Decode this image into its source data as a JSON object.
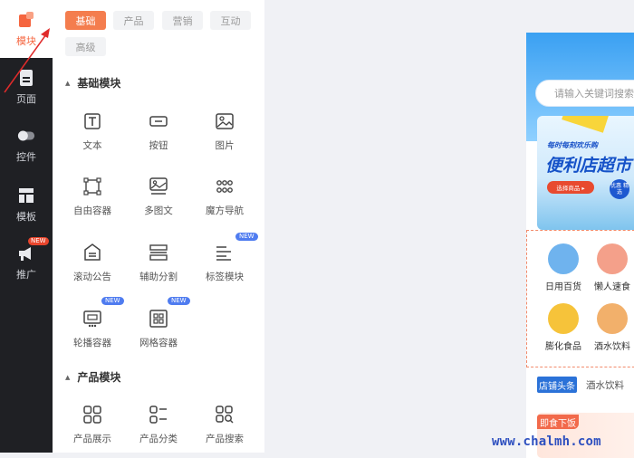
{
  "rail": {
    "items": [
      {
        "label": "模块",
        "icon": "module-icon",
        "active": true
      },
      {
        "label": "页面",
        "icon": "page-icon"
      },
      {
        "label": "控件",
        "icon": "toggle-icon"
      },
      {
        "label": "模板",
        "icon": "template-icon"
      },
      {
        "label": "推广",
        "icon": "megaphone-icon",
        "badge": "NEW"
      }
    ]
  },
  "tabs": [
    "基础",
    "产品",
    "营销",
    "互动",
    "高级"
  ],
  "sections": {
    "basic": {
      "title": "基础模块",
      "widgets": [
        {
          "label": "文本",
          "icon": "text-icon"
        },
        {
          "label": "按钮",
          "icon": "button-icon"
        },
        {
          "label": "图片",
          "icon": "image-icon"
        },
        {
          "label": "自由容器",
          "icon": "free-container-icon"
        },
        {
          "label": "多图文",
          "icon": "multi-image-text-icon"
        },
        {
          "label": "魔方导航",
          "icon": "cube-nav-icon"
        },
        {
          "label": "滚动公告",
          "icon": "notice-icon"
        },
        {
          "label": "辅助分割",
          "icon": "divider-icon"
        },
        {
          "label": "标签模块",
          "icon": "tag-icon",
          "badge": "NEW"
        },
        {
          "label": "轮播容器",
          "icon": "carousel-icon",
          "badge": "NEW"
        },
        {
          "label": "网格容器",
          "icon": "grid-container-icon",
          "badge": "NEW"
        }
      ]
    },
    "product": {
      "title": "产品模块",
      "widgets": [
        {
          "label": "产品展示",
          "icon": "product-display-icon"
        },
        {
          "label": "产品分类",
          "icon": "product-category-icon"
        },
        {
          "label": "产品搜索",
          "icon": "product-search-icon"
        }
      ]
    }
  },
  "preview": {
    "search_placeholder": "请输入关键词搜索",
    "banner_small": "每时每刻欢乐购",
    "banner_big": "便利店超市",
    "banner_button": "选择商品 ▸",
    "banner_badge": "优惠 精选",
    "categories": [
      {
        "label": "日用百货",
        "color": "#6fb3ee"
      },
      {
        "label": "懒人速食",
        "color": "#f4a08a"
      },
      {
        "label": "膨化食品",
        "color": "#f6c33a"
      },
      {
        "label": "酒水饮料",
        "color": "#f2b06b"
      }
    ],
    "news_badge": "店铺头条",
    "news_text": "酒水饮料",
    "hot_badge": "即食下饭"
  },
  "colors": {
    "accent": "#f47d4e",
    "rail_bg": "#1f2024",
    "new_badge_blue": "#4f7cf0",
    "new_badge_red": "#e8452c"
  },
  "watermark": "www.chalmh.com"
}
